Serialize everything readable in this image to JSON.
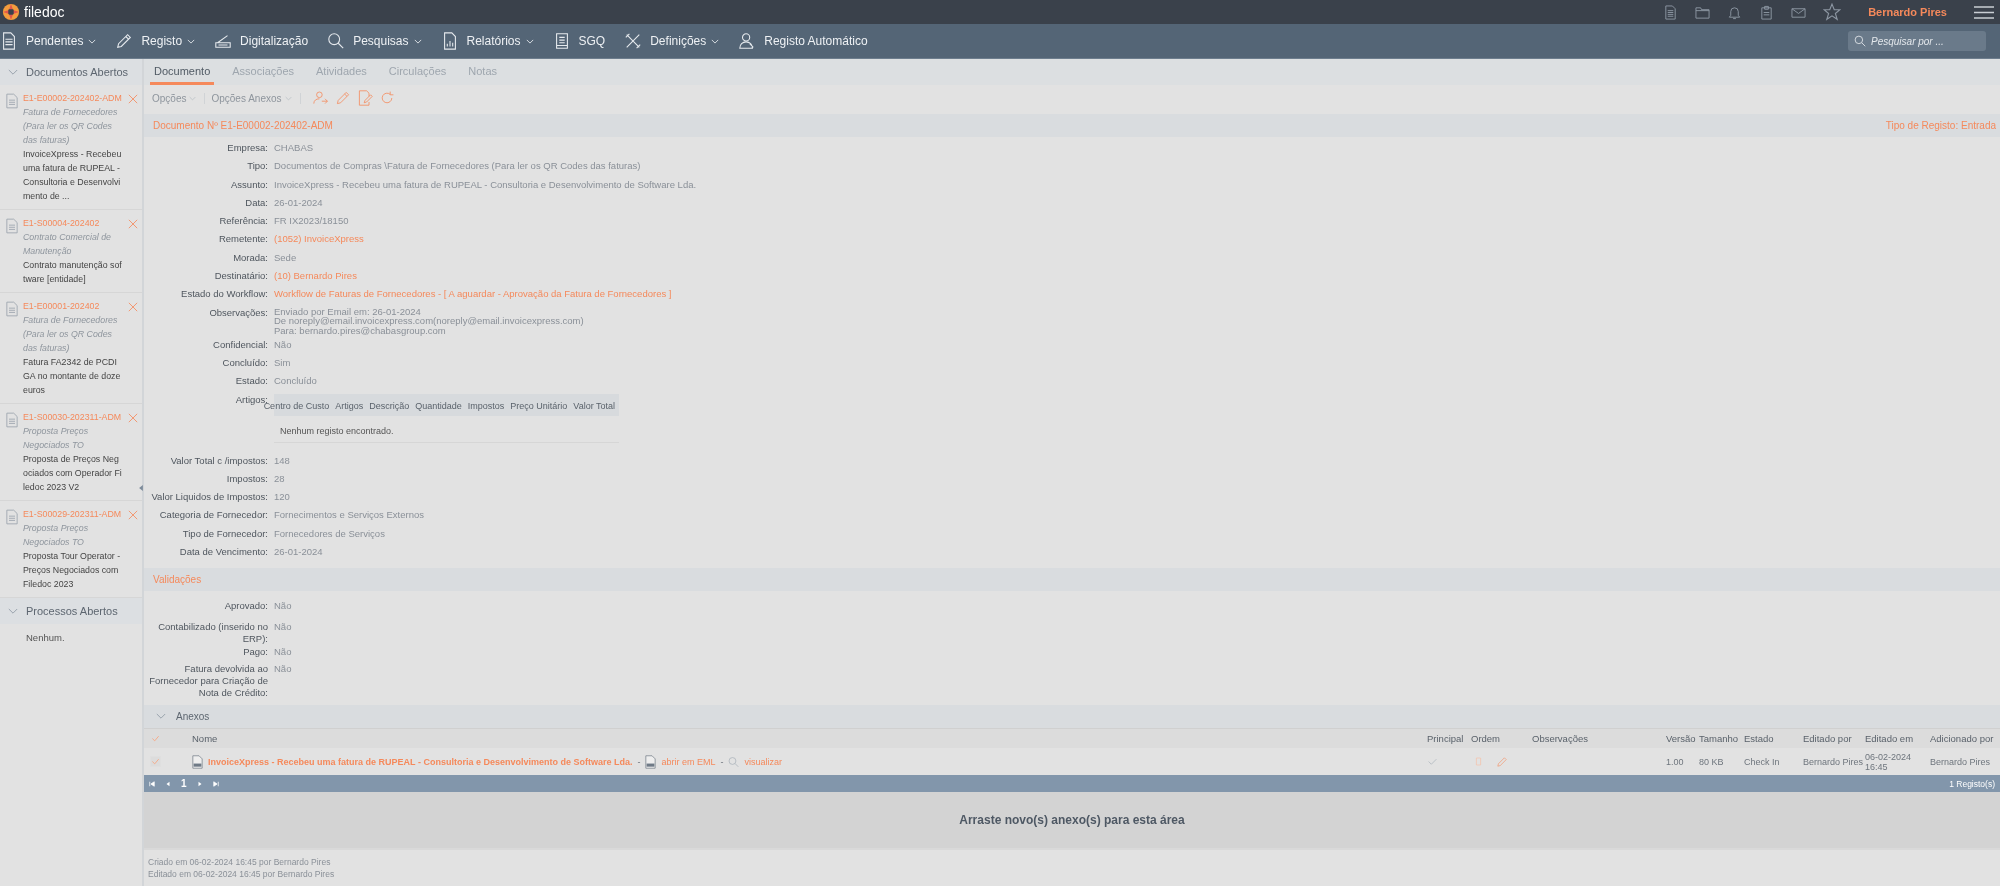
{
  "app": {
    "name": "filedoc"
  },
  "topbar": {
    "user": "Bernardo Pires"
  },
  "nav": [
    {
      "label": "Pendentes",
      "dropdown": true
    },
    {
      "label": "Registo",
      "dropdown": true
    },
    {
      "label": "Digitalização",
      "dropdown": false
    },
    {
      "label": "Pesquisas",
      "dropdown": true
    },
    {
      "label": "Relatórios",
      "dropdown": true
    },
    {
      "label": "SGQ",
      "dropdown": false
    },
    {
      "label": "Definições",
      "dropdown": true
    },
    {
      "label": "Registo Automático",
      "dropdown": false
    }
  ],
  "search": {
    "placeholder": "Pesquisar por ..."
  },
  "sidebar": {
    "sections": [
      {
        "title": "Documentos Abertos",
        "expanded": true,
        "items": [
          {
            "code": "E1-E00002-202402-ADM",
            "type": "Fatura de Fornecedores (Para ler os QR Codes das faturas)",
            "subject": "InvoiceXpress - Recebeu uma fatura de RUPEAL - Consultoria e Desenvolvimento de ..."
          },
          {
            "code": "E1-S00004-202402",
            "type": "Contrato Comercial de Manutenção",
            "subject": "Contrato manutenção software [entidade]"
          },
          {
            "code": "E1-E00001-202402",
            "type": "Fatura de Fornecedores (Para ler os QR Codes das faturas)",
            "subject": "Fatura FA2342 de PCDIGA no montante de doze euros"
          },
          {
            "code": "E1-S00030-202311-ADM",
            "type": "Proposta Preços Negociados TO",
            "subject": "Proposta de Preços Negociados com Operador Filedoc 2023 V2"
          },
          {
            "code": "E1-S00029-202311-ADM",
            "type": "Proposta Preços Negociados TO",
            "subject": "Proposta Tour Operator - Preços Negociados com Filedoc 2023"
          }
        ]
      },
      {
        "title": "Processos Abertos",
        "expanded": true,
        "empty_text": "Nenhum."
      }
    ]
  },
  "tabs": [
    {
      "label": "Documento",
      "selected": true
    },
    {
      "label": "Associações",
      "selected": false
    },
    {
      "label": "Atividades",
      "selected": false
    },
    {
      "label": "Circulações",
      "selected": false
    },
    {
      "label": "Notas",
      "selected": false
    }
  ],
  "toolbar": {
    "menus": [
      "Opções",
      "Opções Anexos"
    ]
  },
  "document": {
    "title": "Documento Nº E1-E00002-202402-ADM",
    "register_type": "Tipo de Registo: Entrada",
    "fields": [
      {
        "kind": "text",
        "label": "Empresa:",
        "value": "CHABAS"
      },
      {
        "kind": "text",
        "label": "Tipo:",
        "value": "Documentos de Compras \\Fatura de Fornecedores (Para ler os QR Codes das faturas)"
      },
      {
        "kind": "text",
        "label": "Assunto:",
        "value": "InvoiceXpress - Recebeu uma fatura de RUPEAL - Consultoria e Desenvolvimento de Software Lda."
      },
      {
        "kind": "text",
        "label": "Data:",
        "value": "26-01-2024"
      },
      {
        "kind": "text",
        "label": "Referência:",
        "value": "FR IX2023/18150"
      },
      {
        "kind": "link",
        "label": "Remetente:",
        "value": "(1052) InvoiceXpress"
      },
      {
        "kind": "text",
        "label": "Morada:",
        "value": "Sede"
      },
      {
        "kind": "link",
        "label": "Destinatário:",
        "value": "(10) Bernardo Pires"
      },
      {
        "kind": "link",
        "label": "Estado do Workflow:",
        "value": "Workflow de Faturas de Fornecedores - [ A aguardar - Aprovação da Fatura de Fornecedores ]"
      },
      {
        "kind": "lines",
        "label": "Observações:",
        "lines": [
          "Enviado por Email em: 26-01-2024",
          "De noreply@email.invoicexpress.com(noreply@email.invoicexpress.com)",
          "Para: bernardo.pires@chabasgroup.com"
        ]
      },
      {
        "kind": "text",
        "label": "Confidencial:",
        "value": "Não"
      },
      {
        "kind": "text",
        "label": "Concluído:",
        "value": "Sim"
      },
      {
        "kind": "text",
        "label": "Estado:",
        "value": "Concluído"
      },
      {
        "kind": "table",
        "label": "Artigos:",
        "columns": [
          "Centro de Custo",
          "Artigos",
          "Descrição",
          "Quantidade",
          "Impostos",
          "Preço Unitário",
          "Valor Total"
        ],
        "empty_text": "Nenhum registo encontrado."
      },
      {
        "kind": "text",
        "label": "Valor Total c /impostos:",
        "value": "148"
      },
      {
        "kind": "text",
        "label": "Impostos:",
        "value": "28"
      },
      {
        "kind": "text",
        "label": "Valor Liquidos de Impostos:",
        "value": "120"
      },
      {
        "kind": "text",
        "label": "Categoria de Fornecedor:",
        "value": "Fornecimentos e Serviços Externos"
      },
      {
        "kind": "text",
        "label": "Tipo de Fornecedor:",
        "value": "Fornecedores de Serviços"
      },
      {
        "kind": "text",
        "label": "Data de Vencimento:",
        "value": "26-01-2024"
      }
    ]
  },
  "validations": {
    "title": "Validações",
    "fields": [
      {
        "label": "Aprovado:",
        "value": "Não"
      },
      {
        "label": "Contabilizado (inserido no ERP):",
        "value": "Não"
      },
      {
        "label": "Pago:",
        "value": "Não"
      },
      {
        "label": "Fatura devolvida ao Fornecedor para Criação de Nota de Crédito:",
        "value": "Não"
      }
    ]
  },
  "attachments": {
    "title": "Anexos",
    "expanded": true,
    "all_checked": true,
    "columns": [
      "Nome",
      "Principal",
      "Ordem",
      "Observações",
      "Versão",
      "Tamanho",
      "Estado",
      "Editado por",
      "Editado em",
      "Adicionado por"
    ],
    "rows": [
      {
        "checked": true,
        "name": "InvoiceXpress - Recebeu uma fatura de RUPEAL - Consultoria e Desenvolvimento de Software Lda.",
        "separator": "-",
        "open_label": "abrir em EML",
        "separator_2": "-",
        "view_label": "visualizar",
        "principal": true,
        "version": "1.00",
        "size": "80 KB",
        "state": "Check In",
        "edited_by": "Bernardo Pires",
        "edited_at": "06-02-2024 16:45",
        "added_by": "Bernardo Pires"
      }
    ],
    "pager": {
      "page": "1",
      "count": "1 Registo(s)"
    },
    "drop_text": "Arraste novo(s) anexo(s) para esta área"
  },
  "footer": [
    "Criado em 06-02-2024 16:45 por Bernardo Pires",
    "Editado em 06-02-2024 16:45 por Bernardo Pires"
  ]
}
